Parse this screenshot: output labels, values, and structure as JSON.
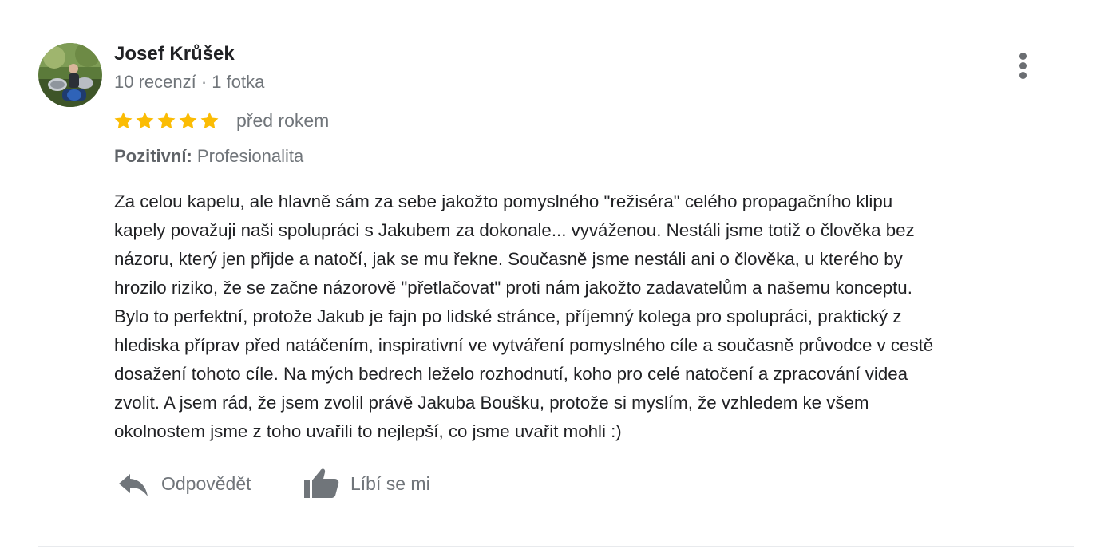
{
  "author": {
    "name": "Josef Krůšek",
    "meta": "10 recenzí · 1 fotka"
  },
  "rating": {
    "stars": 5,
    "max": 5,
    "date": "před rokem"
  },
  "attribute": {
    "label": "Pozitivní:",
    "value": "Profesionalita"
  },
  "review_text": "Za celou kapelu, ale hlavně sám za sebe jakožto pomyslného \"režiséra\" celého propagačního klipu\nkapely považuji naši spolupráci s Jakubem za dokonale... vyváženou. Nestáli jsme totiž o člověka bez\nnázoru, který jen přijde a natočí, jak se mu řekne. Současně jsme nestáli ani o člověka, u kterého by\nhrozilo riziko, že se začne názorově \"přetlačovat\" proti nám jakožto zadavatelům a našemu konceptu.\nBylo to perfektní, protože Jakub je fajn po lidské stránce, příjemný kolega pro spolupráci, praktický z\nhlediska příprav před natáčením, inspirativní ve vytváření pomyslného cíle a současně průvodce v cestě\ndosažení tohoto cíle. Na mých bedrech leželo rozhodnutí, koho pro celé natočení a zpracování videa\nzvolit. A jsem rád, že jsem zvolil právě Jakuba Boušku, protože si myslím, že vzhledem ke všem\nokolnostem jsme z toho uvařili to nejlepší, co jsme uvařit mohli :)",
  "actions": {
    "reply_label": "Odpovědět",
    "like_label": "Líbí se mi"
  },
  "icons": {
    "avatar": "avatar-photo",
    "more": "more-vert-icon",
    "star": "star-icon",
    "reply": "reply-icon",
    "like": "thumb-up-icon"
  },
  "colors": {
    "star": "#fbbc04",
    "text_primary": "#202124",
    "text_secondary": "#70757a",
    "icon": "#6b6e72"
  }
}
